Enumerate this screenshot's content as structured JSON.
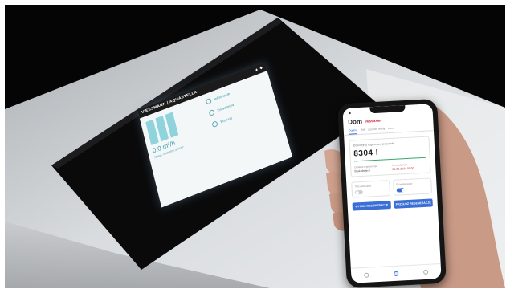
{
  "device_display": {
    "brand": "VIESSMANN | AQUASTELLA",
    "volume": "0.0 m³/h",
    "status_text": "Status: wszystko gotowe",
    "menu": [
      {
        "label": "Informacje"
      },
      {
        "label": "Ustawienia"
      },
      {
        "label": "Funkcje"
      }
    ]
  },
  "phone_app": {
    "title": "Dom",
    "logo": "VIESSMANN",
    "tabs": [
      "Ogólne",
      "Sól",
      "Zużycie wody",
      "Inne"
    ],
    "meter_label": "Do kolejnej regeneracji pozostało",
    "meter_value": "8304 l",
    "info": [
      {
        "label": "Ostatnia regeneracja",
        "value": "Brak danych"
      },
      {
        "label": "Przewidywana",
        "value": "21.08.2024 00:00"
      }
    ],
    "toggles": [
      {
        "label": "Tryb wakacyjny",
        "on": false
      },
      {
        "label": "Przepływ wody",
        "on": true
      }
    ],
    "buttons": [
      "WYMUŚ REGENERACJĘ",
      "PRZEŁÓŻ REGENERACJĘ"
    ],
    "colors": {
      "accent": "#3b6fd6",
      "brand": "#c8202f",
      "ok": "#3aa86b"
    }
  }
}
